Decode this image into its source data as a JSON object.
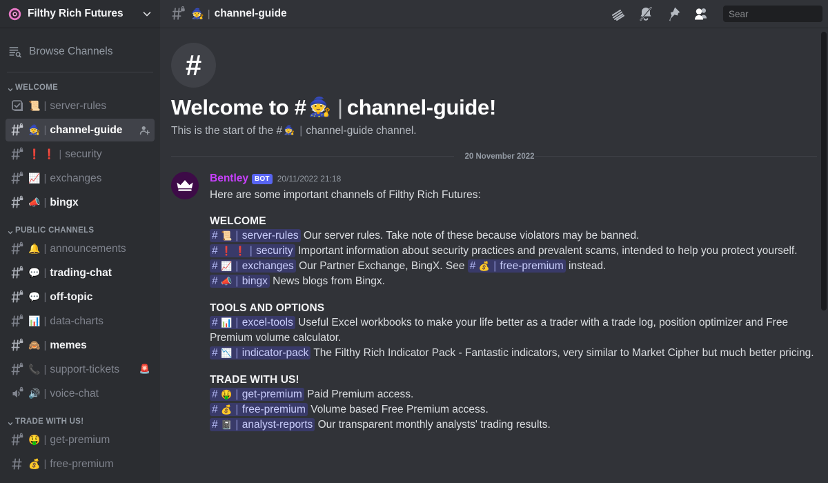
{
  "server": {
    "name": "Filthy Rich Futures",
    "logo_icon": "server-logo-pink-flower",
    "dropdown_icon": "chevron-down-icon"
  },
  "sidebar": {
    "browse_channels": {
      "label": "Browse Channels",
      "icon": "browse-channels-icon"
    },
    "categories": [
      {
        "label": "WELCOME",
        "channels": [
          {
            "name": "server-rules",
            "emoji": "📜",
            "icon": "rules-channel-icon",
            "state": "read"
          },
          {
            "name": "channel-guide",
            "emoji": "🧙",
            "icon": "locked-text-channel-icon",
            "state": "active",
            "trailing_action": "add-member-icon"
          },
          {
            "name": "security",
            "emoji": "❗ ❗",
            "icon": "locked-text-channel-icon",
            "state": "read"
          },
          {
            "name": "exchanges",
            "emoji": "📈",
            "icon": "locked-text-channel-icon",
            "state": "read"
          },
          {
            "name": "bingx",
            "emoji": "📣",
            "icon": "locked-text-channel-icon",
            "state": "unread"
          }
        ]
      },
      {
        "label": "PUBLIC CHANNELS",
        "channels": [
          {
            "name": "announcements",
            "emoji": "🔔",
            "icon": "locked-text-channel-icon",
            "state": "read"
          },
          {
            "name": "trading-chat",
            "emoji": "💬",
            "icon": "locked-text-channel-icon",
            "state": "unread"
          },
          {
            "name": "off-topic",
            "emoji": "💬",
            "icon": "locked-text-channel-icon",
            "state": "unread"
          },
          {
            "name": "data-charts",
            "emoji": "📊",
            "icon": "locked-text-channel-icon",
            "state": "read"
          },
          {
            "name": "memes",
            "emoji": "🙈",
            "icon": "locked-text-channel-icon",
            "state": "unread"
          },
          {
            "name": "support-tickets",
            "emoji": "📞",
            "trailing_emoji": "🚨",
            "icon": "locked-text-channel-icon",
            "state": "read"
          },
          {
            "name": "voice-chat",
            "emoji": "🔊",
            "icon": "locked-voice-channel-icon",
            "state": "read"
          }
        ]
      },
      {
        "label": "TRADE WITH US!",
        "channels": [
          {
            "name": "get-premium",
            "emoji": "🤑",
            "icon": "locked-text-channel-icon",
            "state": "read"
          },
          {
            "name": "free-premium",
            "emoji": "💰",
            "icon": "text-channel-icon",
            "state": "read"
          }
        ]
      }
    ]
  },
  "topbar": {
    "channel_name": "channel-guide",
    "channel_emoji": "🧙",
    "separator": "|",
    "icons": [
      "threads-icon",
      "notification-muted-icon",
      "pinned-messages-icon",
      "member-list-icon"
    ],
    "search": {
      "value": "",
      "placeholder": "Sear"
    }
  },
  "intro": {
    "hash": "#",
    "title_prefix": "Welcome to #",
    "title_emoji": "🧙",
    "title_separator": "|",
    "title_suffix": "channel-guide!",
    "subtitle_prefix": "This is the start of the #",
    "subtitle_emoji": "🧙",
    "subtitle_separator": "|",
    "subtitle_suffix": "channel-guide channel."
  },
  "date_divider": "20 November 2022",
  "message": {
    "author": "Bentley",
    "bot_badge": "BOT",
    "timestamp": "20/11/2022 21:18",
    "avatar_icon": "crown-avatar",
    "intro_line": "Here are some important channels of Filthy Rich Futures:",
    "blocks": [
      {
        "title": "WELCOME",
        "lines": [
          {
            "mention": {
              "emoji": "📜",
              "name": "server-rules"
            },
            "text": "Our server rules. Take note of these because violators may be banned."
          },
          {
            "mention": {
              "emoji": "❗ ❗",
              "name": "security"
            },
            "text": "Important information about security practices and prevalent scams, intended to help you protect yourself."
          },
          {
            "mention": {
              "emoji": "📈",
              "name": "exchanges"
            },
            "text": "Our Partner Exchange, BingX. See ",
            "mention2": {
              "emoji": "💰",
              "name": "free-premium"
            },
            "text2": " instead."
          },
          {
            "mention": {
              "emoji": "📣",
              "name": "bingx"
            },
            "text": "News blogs from Bingx."
          }
        ]
      },
      {
        "title": "TOOLS AND OPTIONS",
        "lines": [
          {
            "mention": {
              "emoji": "📊",
              "name": "excel-tools"
            },
            "text": "Useful Excel workbooks to make your life better as a trader with a trade log, position optimizer and Free Premium volume calculator."
          },
          {
            "mention": {
              "emoji": "📉",
              "name": "indicator-pack"
            },
            "text": "The Filthy Rich Indicator Pack - Fantastic indicators, very similar to Market Cipher but much better pricing."
          }
        ]
      },
      {
        "title": "TRADE WITH US!",
        "lines": [
          {
            "mention": {
              "emoji": "🤑",
              "name": "get-premium"
            },
            "text": "Paid Premium access."
          },
          {
            "mention": {
              "emoji": "💰",
              "name": "free-premium"
            },
            "text": "Volume based Free Premium access."
          },
          {
            "mention": {
              "emoji": "📓",
              "name": "analyst-reports"
            },
            "text": "Our transparent monthly analysts' trading results."
          }
        ]
      }
    ]
  },
  "colors": {
    "sidebar_bg": "#2b2d31",
    "main_bg": "#313338",
    "accent": "#5865f2",
    "author": "#c940ff",
    "mention_bg": "#43439e",
    "mention_fg": "#c9cdfb"
  }
}
